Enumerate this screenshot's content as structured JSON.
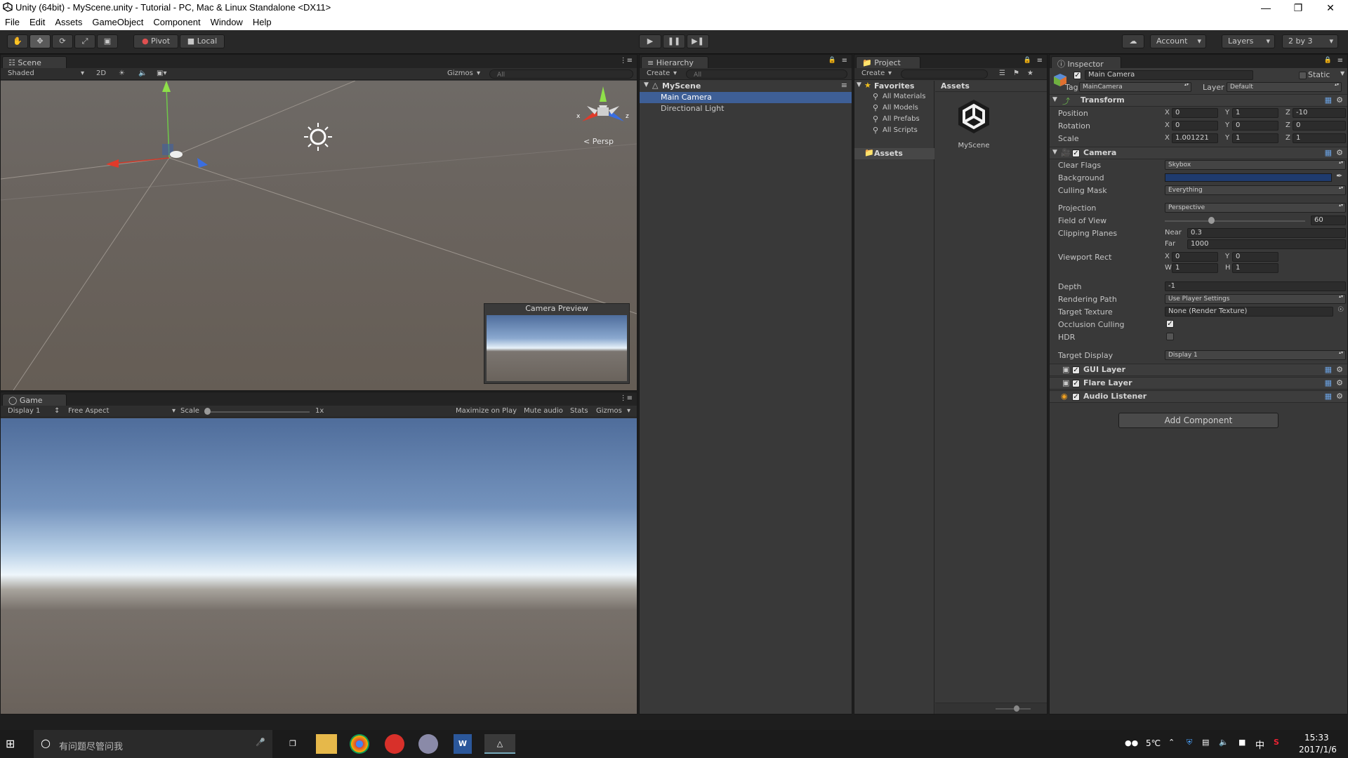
{
  "window": {
    "title": "Unity (64bit) - MyScene.unity - Tutorial - PC, Mac & Linux Standalone <DX11>",
    "controls": [
      "—",
      "❐",
      "✕"
    ]
  },
  "menu": [
    "File",
    "Edit",
    "Assets",
    "GameObject",
    "Component",
    "Window",
    "Help"
  ],
  "toolbar": {
    "pivot": "Pivot",
    "local": "Local",
    "account": "Account",
    "layers": "Layers",
    "layout": "2 by 3"
  },
  "scene": {
    "tab": "Scene",
    "shading": "Shaded",
    "mode_2d": "2D",
    "gizmos": "Gizmos",
    "search": "All",
    "persp": "Persp",
    "axis_x": "x",
    "axis_z": "z",
    "camera_preview": "Camera Preview"
  },
  "game": {
    "tab": "Game",
    "display": "Display 1",
    "aspect": "Free Aspect",
    "scale_label": "Scale",
    "scale_value": "1x",
    "maximize": "Maximize on Play",
    "mute": "Mute audio",
    "stats": "Stats",
    "gizmos": "Gizmos"
  },
  "hierarchy": {
    "tab": "Hierarchy",
    "create": "Create",
    "search": "All",
    "scene": "MyScene",
    "items": [
      {
        "label": "Main Camera",
        "selected": true
      },
      {
        "label": "Directional Light",
        "selected": false
      }
    ]
  },
  "project": {
    "tab": "Project",
    "create": "Create",
    "favorites": "Favorites",
    "favorite_items": [
      "All Materials",
      "All Models",
      "All Prefabs",
      "All Scripts"
    ],
    "assets_folder": "Assets",
    "assets_header": "Assets",
    "asset_items": [
      "MyScene"
    ]
  },
  "inspector": {
    "tab": "Inspector",
    "object_name": "Main Camera",
    "static": "Static",
    "tag_label": "Tag",
    "tag_value": "MainCamera",
    "layer_label": "Layer",
    "layer_value": "Default",
    "transform": {
      "title": "Transform",
      "position_label": "Position",
      "rotation_label": "Rotation",
      "scale_label": "Scale",
      "position": [
        "0",
        "1",
        "-10"
      ],
      "rotation": [
        "0",
        "0",
        "0"
      ],
      "scale": [
        "1.001221",
        "1",
        "1"
      ]
    },
    "camera": {
      "title": "Camera",
      "clear_flags_label": "Clear Flags",
      "clear_flags": "Skybox",
      "background_label": "Background",
      "background_color": "#1f3b6e",
      "culling_mask_label": "Culling Mask",
      "culling_mask": "Everything",
      "projection_label": "Projection",
      "projection": "Perspective",
      "fov_label": "Field of View",
      "fov": "60",
      "fov_fraction": 0.33,
      "clipping_label": "Clipping Planes",
      "near_label": "Near",
      "near": "0.3",
      "far_label": "Far",
      "far": "1000",
      "viewport_label": "Viewport Rect",
      "viewport": {
        "x": "0",
        "y": "0",
        "w": "1",
        "h": "1"
      },
      "depth_label": "Depth",
      "depth": "-1",
      "rendering_label": "Rendering Path",
      "rendering": "Use Player Settings",
      "target_texture_label": "Target Texture",
      "target_texture": "None (Render Texture)",
      "occlusion_label": "Occlusion Culling",
      "occlusion": true,
      "hdr_label": "HDR",
      "hdr": false,
      "target_display_label": "Target Display",
      "target_display": "Display 1"
    },
    "components": [
      "GUI Layer",
      "Flare Layer",
      "Audio Listener"
    ],
    "add_component": "Add Component"
  },
  "taskbar": {
    "search_placeholder": "有问题尽管问我",
    "weather": "5℃",
    "ime": "中",
    "time": "15:33",
    "date": "2017/1/6"
  }
}
